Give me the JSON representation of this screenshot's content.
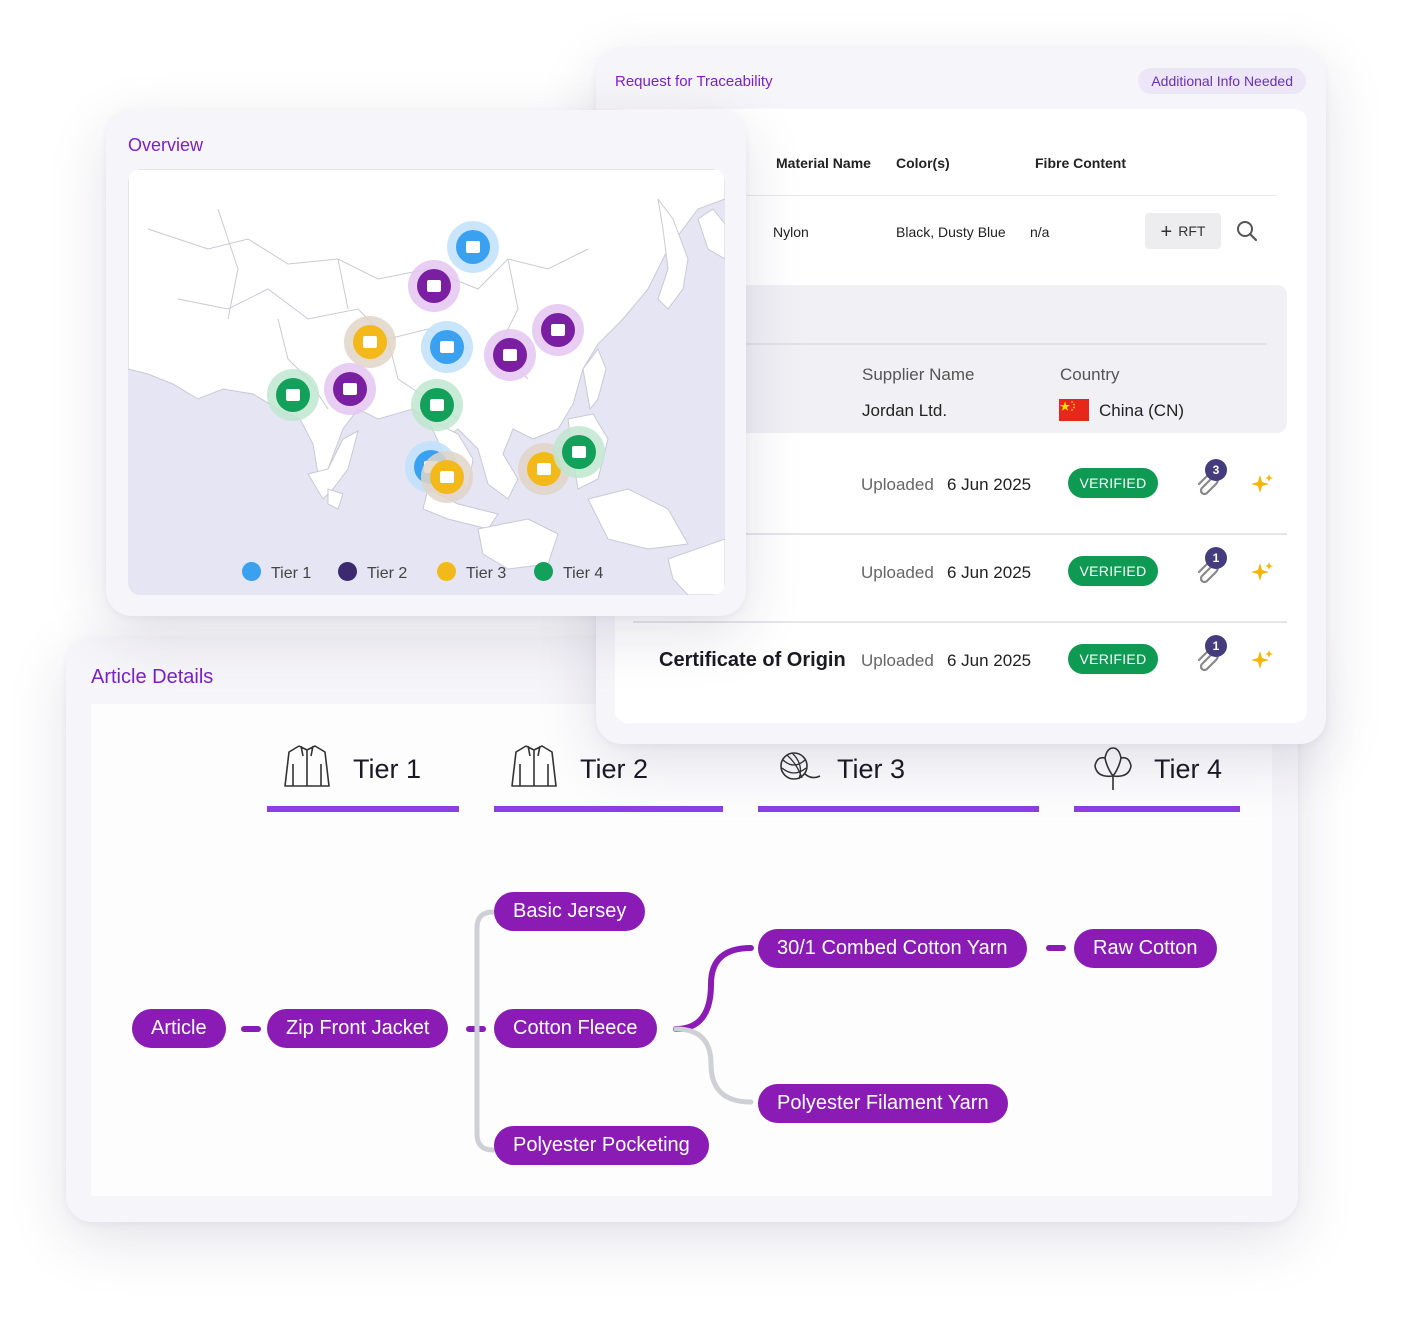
{
  "rft": {
    "title": "Request for Traceability",
    "status": "Additional Info Needed",
    "headers": {
      "material": "Material Name",
      "colors": "Color(s)",
      "fibre": "Fibre Content"
    },
    "row": {
      "material": "Nylon",
      "colors": "Black, Dusty Blue",
      "fibre": "n/a"
    },
    "add_button": "RFT",
    "supplier": {
      "name_label": "Supplier Name",
      "country_label": "Country",
      "name": "Jordan Ltd.",
      "country": "China (CN)",
      "partial_char": ")"
    },
    "documents": [
      {
        "name": "",
        "uploaded_label": "Uploaded",
        "date": "6 Jun 2025",
        "status": "VERIFIED",
        "attachments": "3"
      },
      {
        "name": "",
        "uploaded_label": "Uploaded",
        "date": "6 Jun 2025",
        "status": "VERIFIED",
        "attachments": "1"
      },
      {
        "name": "Certificate of Origin",
        "uploaded_label": "Uploaded",
        "date": "6 Jun 2025",
        "status": "VERIFIED",
        "attachments": "1"
      }
    ]
  },
  "overview": {
    "title": "Overview",
    "legend": [
      {
        "label": "Tier 1",
        "color": "#3aa0f0"
      },
      {
        "label": "Tier 2",
        "color": "#3b2a6e"
      },
      {
        "label": "Tier 3",
        "color": "#f3b91b"
      },
      {
        "label": "Tier 4",
        "color": "#12a05a"
      }
    ],
    "markers": [
      {
        "tier": "Tier 1",
        "icon": "tshirt-icon"
      },
      {
        "tier": "Tier 2",
        "icon": "factory-icon"
      },
      {
        "tier": "Tier 3",
        "icon": "spool-icon"
      },
      {
        "tier": "Tier 1",
        "icon": "vest-icon"
      },
      {
        "tier": "Tier 2",
        "icon": "factory-icon"
      },
      {
        "tier": "Tier 2",
        "icon": "factory-icon"
      },
      {
        "tier": "Tier 4",
        "icon": "sprout-icon"
      },
      {
        "tier": "Tier 2",
        "icon": "factory-icon"
      },
      {
        "tier": "Tier 4",
        "icon": "leaf-icon"
      },
      {
        "tier": "Tier 1",
        "icon": "vest-icon"
      },
      {
        "tier": "Tier 3",
        "icon": "spool-icon"
      },
      {
        "tier": "Tier 3",
        "icon": "spool-icon"
      },
      {
        "tier": "Tier 4",
        "icon": "seeds-icon"
      }
    ]
  },
  "article": {
    "title": "Article Details",
    "tiers": [
      {
        "label": "Tier 1",
        "icon": "jacket-icon"
      },
      {
        "label": "Tier 2",
        "icon": "jacket-icon"
      },
      {
        "label": "Tier 3",
        "icon": "yarn-ball-icon"
      },
      {
        "label": "Tier 4",
        "icon": "cotton-plant-icon"
      }
    ],
    "nodes": {
      "article": "Article",
      "zip_front_jacket": "Zip Front Jacket",
      "basic_jersey": "Basic Jersey",
      "cotton_fleece": "Cotton Fleece",
      "polyester_pocketing": "Polyester Pocketing",
      "combed_cotton_yarn": "30/1 Combed Cotton Yarn",
      "polyester_filament_yarn": "Polyester Filament Yarn",
      "raw_cotton": "Raw Cotton"
    }
  }
}
